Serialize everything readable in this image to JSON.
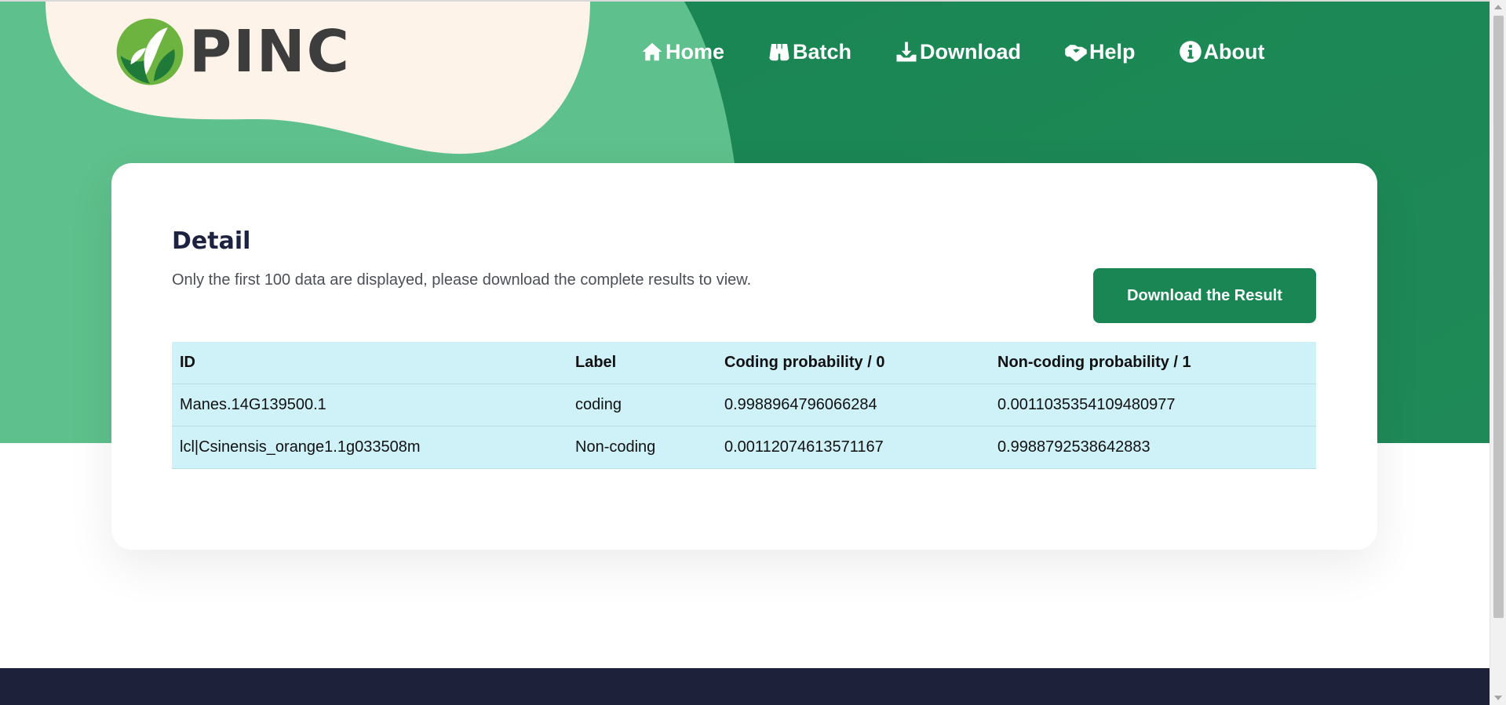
{
  "brand": {
    "name": "PINC"
  },
  "nav": {
    "items": [
      {
        "label": "Home",
        "icon": "home-icon"
      },
      {
        "label": "Batch",
        "icon": "binoculars-icon"
      },
      {
        "label": "Download",
        "icon": "download-icon"
      },
      {
        "label": "Help",
        "icon": "handshake-icon"
      },
      {
        "label": "About",
        "icon": "info-icon"
      }
    ]
  },
  "detail": {
    "title": "Detail",
    "description": "Only the first 100 data are displayed, please download the complete results to view.",
    "download_button": "Download the Result"
  },
  "table": {
    "headers": [
      "ID",
      "Label",
      "Coding probability / 0",
      "Non-coding probability / 1"
    ],
    "rows": [
      [
        "Manes.14G139500.1",
        "coding",
        "0.9988964796066284",
        "0.0011035354109480977"
      ],
      [
        "lcl|Csinensis_orange1.1g033508m",
        "Non-coding",
        "0.00112074613571167",
        "0.9988792538642883"
      ]
    ]
  },
  "colors": {
    "hero_light_green": "#5ec08c",
    "hero_dark_green": "#1a8653",
    "blob_cream": "#fdf3e8",
    "button_green": "#1a8653",
    "table_bg": "#cff1f8",
    "footer": "#1e213a"
  }
}
